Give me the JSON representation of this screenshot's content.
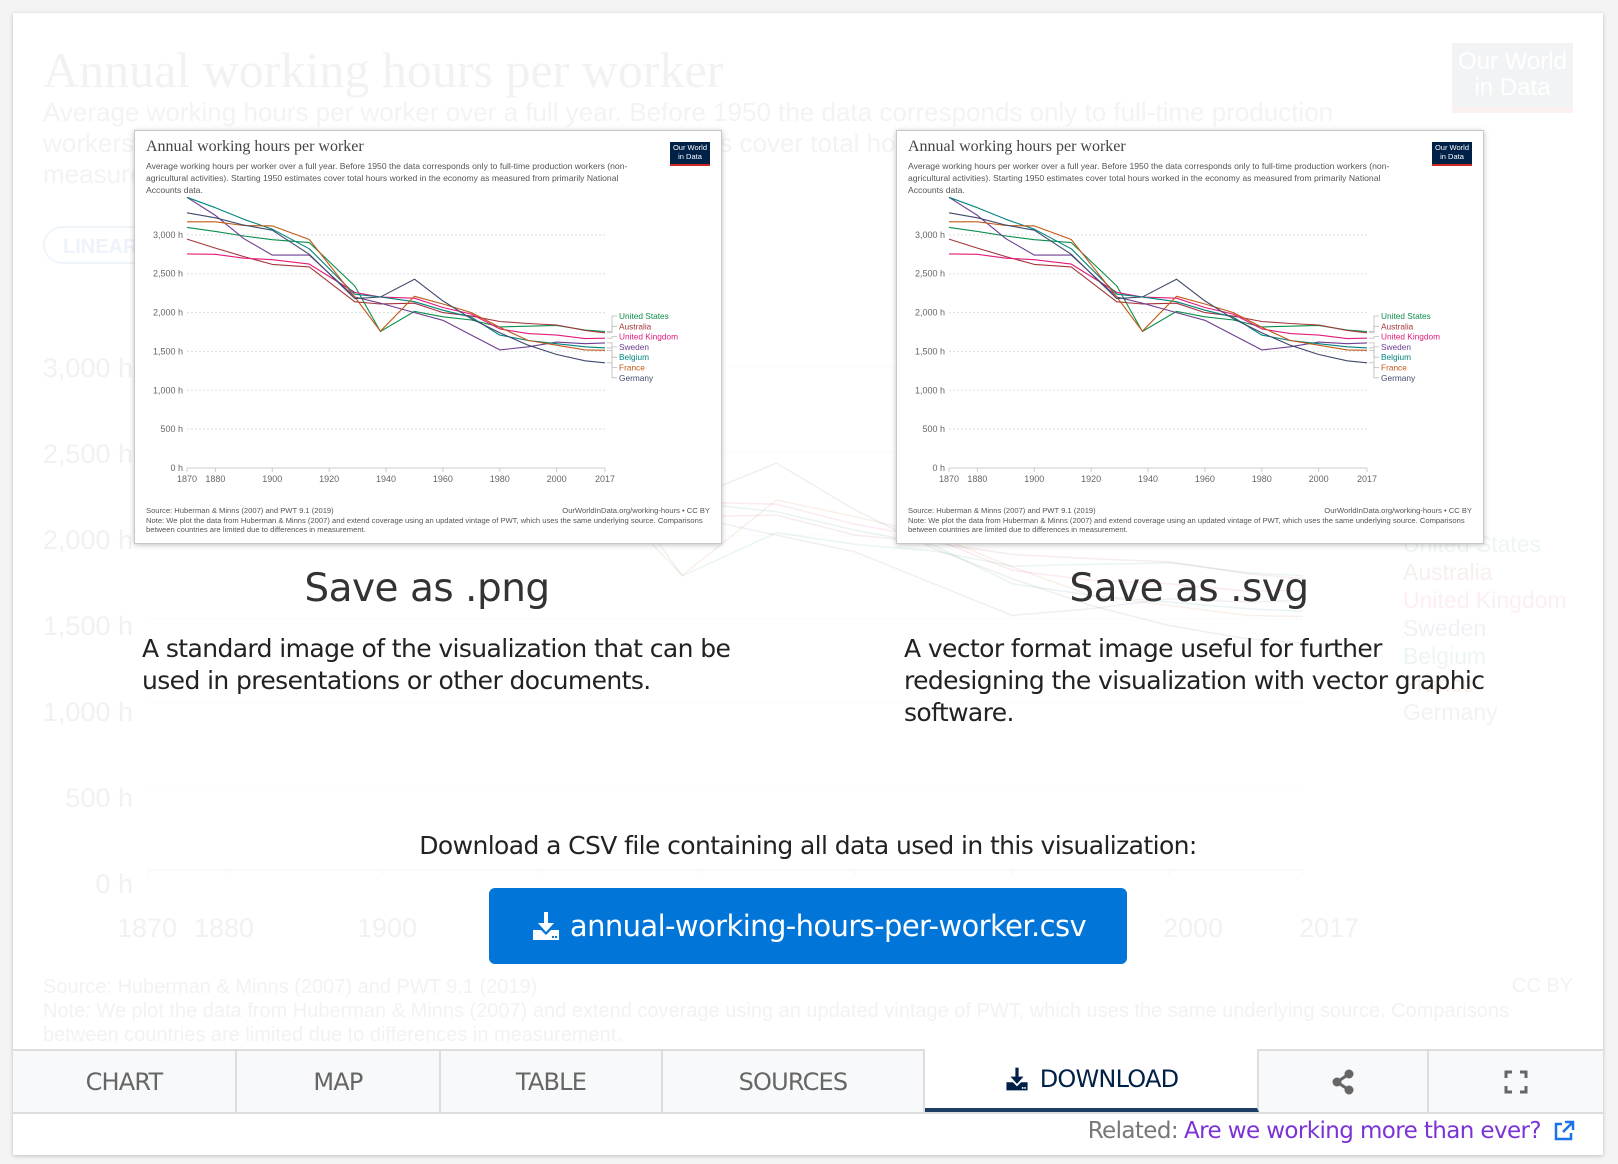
{
  "background_chart": {
    "title": "Annual working hours per worker",
    "subtitle": "Average working hours per worker over a full year. Before 1950 the data corresponds only to full-time production workers (non-agricultural activities). Starting 1950 estimates cover total hours worked in the economy as measured from primarily National Accounts data.",
    "logo": "Our World in Data",
    "scale_button": "LINEAR",
    "y_ticks": [
      "3,000 h",
      "2,500 h",
      "2,000 h",
      "1,500 h",
      "1,000 h",
      "500 h",
      "0 h"
    ],
    "x_ticks": [
      "1870",
      "1880",
      "1900",
      "2000",
      "2017"
    ],
    "legend": [
      "United States",
      "Australia",
      "United Kingdom",
      "Sweden",
      "Belgium",
      "France",
      "Germany"
    ],
    "source": "Source: Huberman & Minns (2007) and PWT 9.1 (2019)",
    "note": "Note: We plot the data from Huberman & Minns (2007) and extend coverage using an updated vintage of PWT, which uses the same underlying source. Comparisons between countries are limited due to differences in measurement.",
    "license": "CC BY"
  },
  "chart_data": {
    "type": "line",
    "title": "Annual working hours per worker",
    "subtitle": "Average working hours per worker over a full year. Before 1950 the data corresponds only to full-time production workers (non-agricultural activities). Starting 1950 estimates cover total hours worked in the economy as measured from primarily National Accounts data.",
    "xlabel": "",
    "ylabel": "",
    "xlim": [
      1870,
      2017
    ],
    "ylim": [
      0,
      3500
    ],
    "x_ticks": [
      "1870",
      "1880",
      "1900",
      "1920",
      "1940",
      "1960",
      "1980",
      "2000",
      "2017"
    ],
    "y_ticks": [
      "0 h",
      "500 h",
      "1,000 h",
      "1,500 h",
      "2,000 h",
      "2,500 h",
      "3,000 h"
    ],
    "y_tick_values": [
      0,
      500,
      1000,
      1500,
      2000,
      2500,
      3000
    ],
    "grid": true,
    "legend_position": "right",
    "x": [
      1870,
      1880,
      1890,
      1900,
      1913,
      1929,
      1938,
      1950,
      1960,
      1970,
      1980,
      1990,
      2000,
      2010,
      2017
    ],
    "series": [
      {
        "name": "United States",
        "color": "#0a8f4b",
        "values": [
          3096,
          3045,
          2985,
          2938,
          2900,
          2342,
          1756,
          2015,
          1945,
          1905,
          1815,
          1825,
          1835,
          1775,
          1757
        ]
      },
      {
        "name": "Australia",
        "color": "#a3373b",
        "values": [
          2945,
          2830,
          2720,
          2620,
          2588,
          2139,
          2110,
          2120,
          2000,
          1955,
          1885,
          1860,
          1840,
          1770,
          1740
        ]
      },
      {
        "name": "United Kingdom",
        "color": "#e21b7a",
        "values": [
          2755,
          2750,
          2700,
          2680,
          2624,
          2260,
          2200,
          2185,
          2065,
          1980,
          1790,
          1730,
          1710,
          1665,
          1670
        ]
      },
      {
        "name": "Sweden",
        "color": "#6d3e91",
        "values": [
          3483,
          3250,
          2950,
          2740,
          2740,
          2200,
          2120,
          2000,
          1900,
          1710,
          1520,
          1560,
          1620,
          1600,
          1610
        ]
      },
      {
        "name": "Belgium",
        "color": "#00847e",
        "values": [
          3483,
          3350,
          3200,
          3073,
          2820,
          2237,
          2200,
          2140,
          2030,
          1940,
          1710,
          1640,
          1600,
          1560,
          1545
        ]
      },
      {
        "name": "France",
        "color": "#c05917",
        "values": [
          3168,
          3168,
          3120,
          3115,
          2940,
          2200,
          1760,
          2210,
          2110,
          2000,
          1810,
          1640,
          1580,
          1520,
          1514
        ]
      },
      {
        "name": "Germany",
        "color": "#3f4a6b",
        "values": [
          3284,
          3220,
          3125,
          3060,
          2750,
          2180,
          2200,
          2430,
          2150,
          1920,
          1740,
          1580,
          1460,
          1380,
          1354
        ]
      }
    ],
    "source": "Source: Huberman & Minns (2007) and PWT 9.1 (2019)",
    "url": "OurWorldInData.org/working-hours • CC BY",
    "note": "Note: We plot the data from Huberman & Minns (2007) and extend coverage using an updated vintage of PWT, which uses the same underlying source. Comparisons between countries are limited due to differences in measurement.",
    "logo": "Our World in Data"
  },
  "download": {
    "png": {
      "title": "Save as .png",
      "description": "A standard image of the visualization that can be used in presentations or other documents."
    },
    "svg": {
      "title": "Save as .svg",
      "description": "A vector format image useful for further redesigning the visualization with vector graphic software."
    },
    "csv_label": "Download a CSV file containing all data used in this visualization:",
    "csv_filename": "annual-working-hours-per-worker.csv"
  },
  "tabs": [
    {
      "label": "CHART",
      "active": false
    },
    {
      "label": "MAP",
      "active": false
    },
    {
      "label": "TABLE",
      "active": false
    },
    {
      "label": "SOURCES",
      "active": false
    },
    {
      "label": "DOWNLOAD",
      "active": true,
      "icon": "download-icon"
    },
    {
      "label": "",
      "icon": "share-icon"
    },
    {
      "label": "",
      "icon": "fullscreen-icon"
    }
  ],
  "related": {
    "label": "Related:",
    "link_text": "Are we working more than ever?",
    "icon": "external-link-icon"
  },
  "colors": {
    "accent_blue": "#0275d8",
    "owid_navy": "#002147",
    "owid_red": "#ce261e",
    "related_link": "#7a33d6",
    "active_tab_underline": "#1d3d63"
  }
}
